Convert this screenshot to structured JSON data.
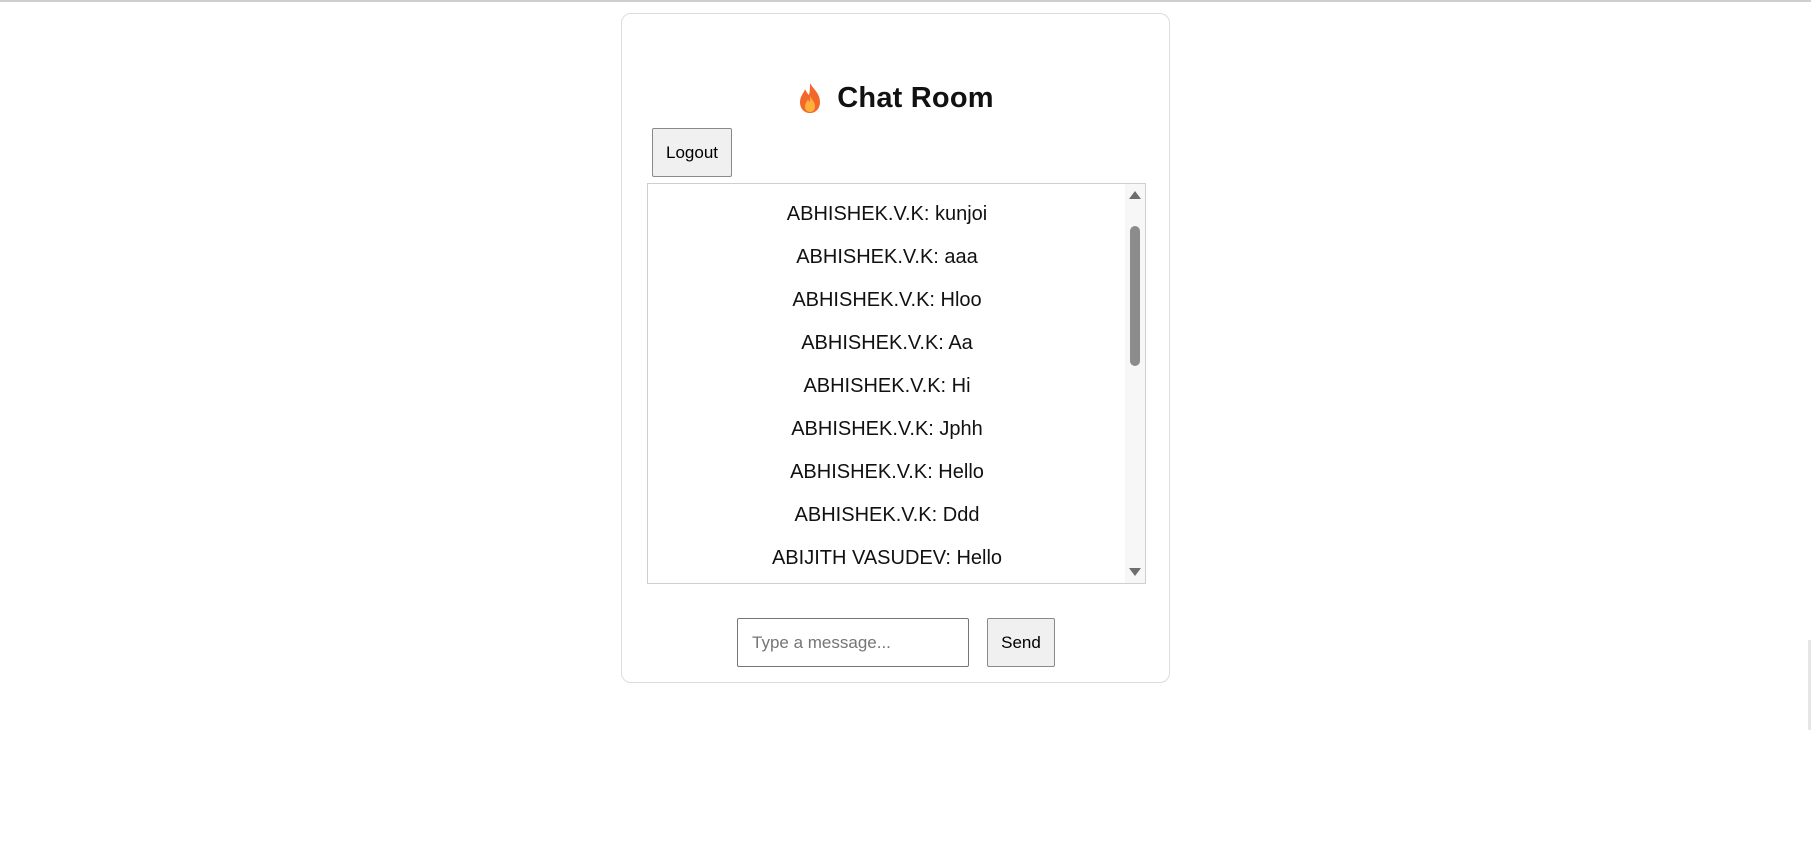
{
  "header": {
    "title": "Chat Room",
    "icon": "fire-icon"
  },
  "toolbar": {
    "logout_label": "Logout"
  },
  "messages": [
    "ABHISHEK.V.K: kunjoi",
    "ABHISHEK.V.K: aaa",
    "ABHISHEK.V.K: Hloo",
    "ABHISHEK.V.K: Aa",
    "ABHISHEK.V.K: Hi",
    "ABHISHEK.V.K: Jphh",
    "ABHISHEK.V.K: Hello",
    "ABHISHEK.V.K: Ddd",
    "ABIJITH VASUDEV: Hello"
  ],
  "composer": {
    "value": "",
    "placeholder": "Type a message...",
    "send_label": "Send"
  },
  "colors": {
    "flame_outer": "#f2682a",
    "flame_inner": "#ffb03b",
    "button_bg": "#f0f0f0",
    "border": "#cfcfcf"
  }
}
